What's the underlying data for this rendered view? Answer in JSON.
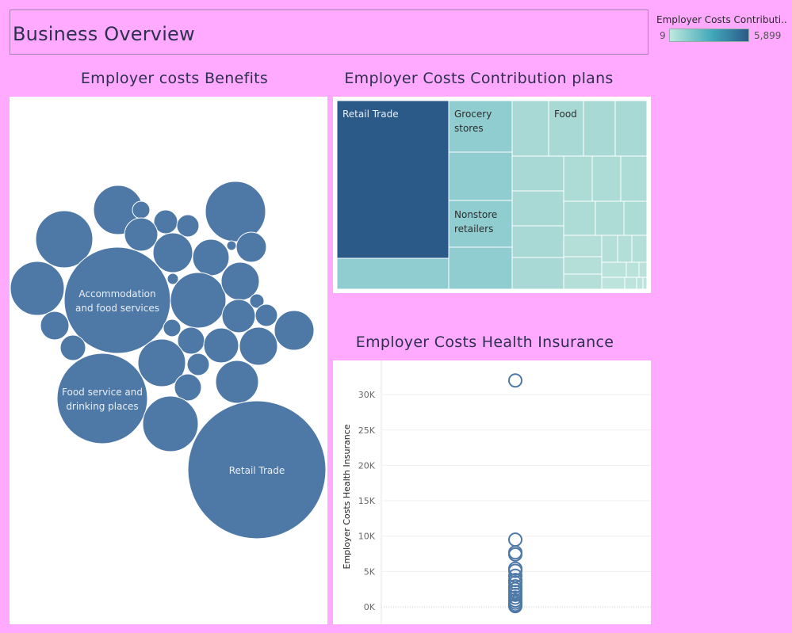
{
  "dashboard": {
    "title": "Business Overview",
    "legend": {
      "title": "Employer Costs Contributi..",
      "min": "9",
      "max": "5,899",
      "color_low": "#bde9df",
      "color_high": "#2c5a88"
    },
    "background": "#ffaaff"
  },
  "benefits_chart": {
    "title": "Employer costs Benefits",
    "bubble_color": "#4e79a7",
    "labels": {
      "accommodation": [
        "Accommodation",
        "and food services"
      ],
      "food_service": [
        "Food service and",
        "drinking places"
      ],
      "retail": "Retail Trade"
    }
  },
  "contribution_chart": {
    "title": "Employer Costs Contribution plans",
    "labels": {
      "retail": "Retail Trade",
      "grocery": [
        "Grocery",
        "stores"
      ],
      "nonstore": [
        "Nonstore",
        "retailers"
      ],
      "food": "Food"
    }
  },
  "health_chart": {
    "title": "Employer Costs  Health Insurance",
    "ylabel": "Employer Costs Health Insurance",
    "yticks": [
      "0K",
      "5K",
      "10K",
      "15K",
      "20K",
      "25K",
      "30K"
    ]
  },
  "chart_data": [
    {
      "type": "scatter",
      "title": "Employer Costs  Health Insurance",
      "ylabel": "Employer Costs Health Insurance",
      "ylim": [
        0,
        33000
      ],
      "grid": true,
      "values": [
        32000,
        9500,
        7700,
        7400,
        5400,
        5100,
        4400,
        3800,
        3400,
        2900,
        2500,
        2100,
        1700,
        1300,
        900,
        600,
        300,
        100
      ]
    }
  ]
}
